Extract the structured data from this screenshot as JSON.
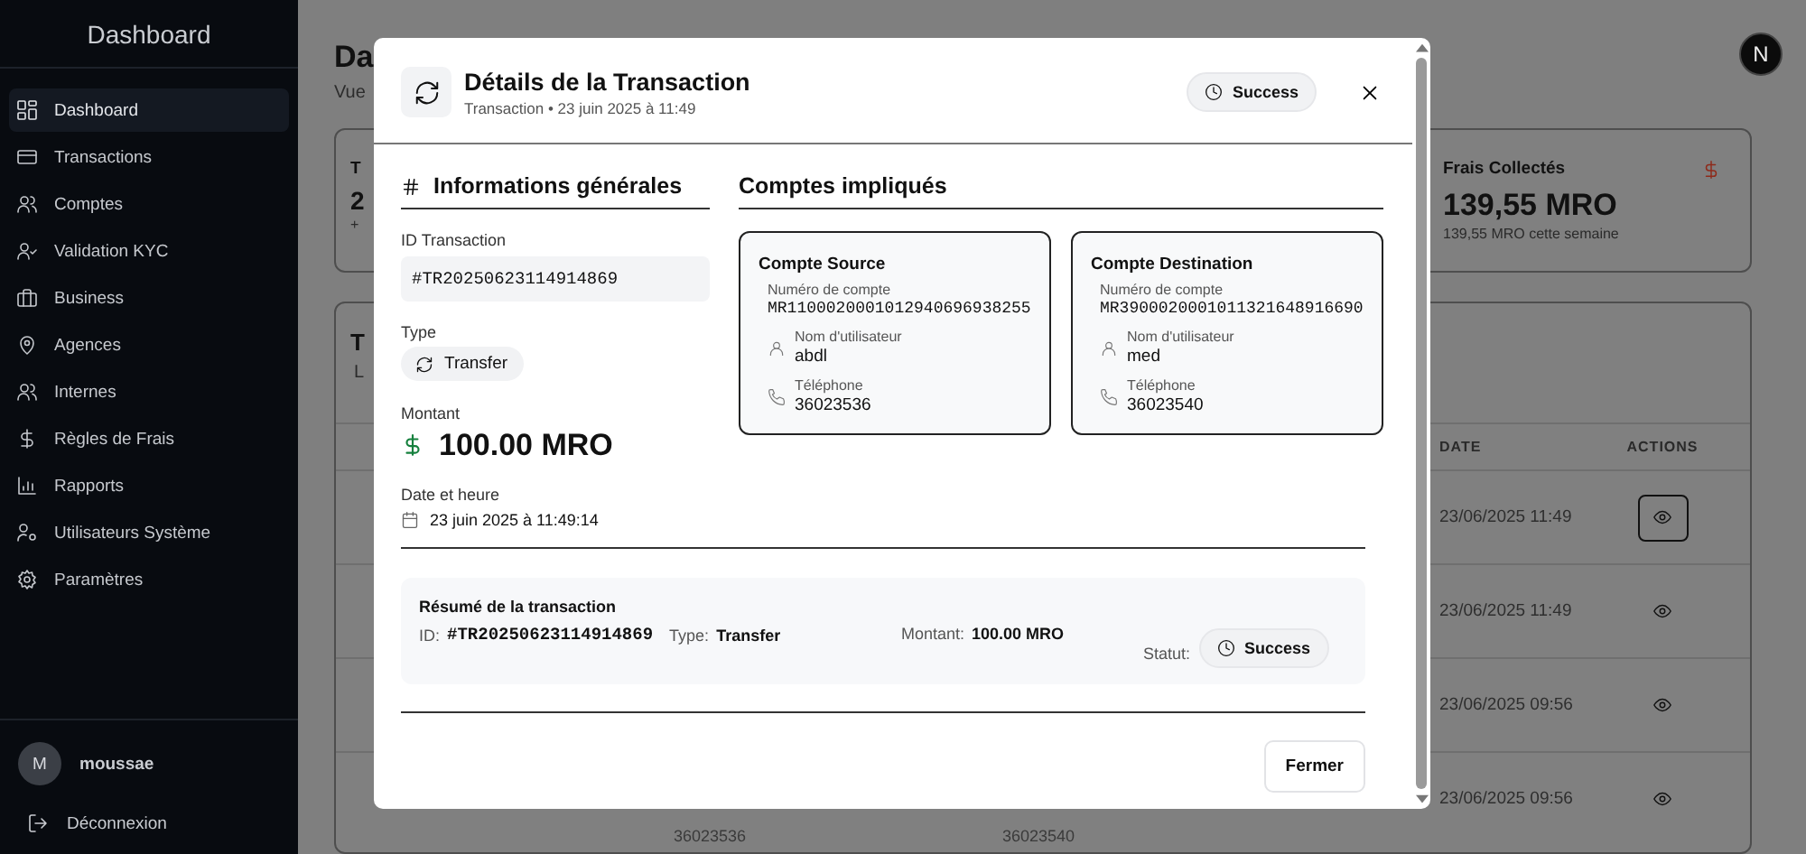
{
  "sidebar": {
    "title": "Dashboard",
    "items": [
      {
        "label": "Dashboard",
        "selected": true
      },
      {
        "label": "Transactions",
        "selected": false
      },
      {
        "label": "Comptes",
        "selected": false
      },
      {
        "label": "Validation KYC",
        "selected": false
      },
      {
        "label": "Business",
        "selected": false
      },
      {
        "label": "Agences",
        "selected": false
      },
      {
        "label": "Internes",
        "selected": false
      },
      {
        "label": "Règles de Frais",
        "selected": false
      },
      {
        "label": "Rapports",
        "selected": false
      },
      {
        "label": "Utilisateurs Système",
        "selected": false
      },
      {
        "label": "Paramètres",
        "selected": false
      }
    ],
    "user": {
      "initial": "M",
      "name": "moussae"
    },
    "logout": "Déconnexion"
  },
  "page": {
    "title": "Da",
    "subtitle": "Vue",
    "avatar": "N"
  },
  "stat_cards": [
    {
      "title": "T",
      "value": "2",
      "note": "+"
    },
    {
      "title": "Frais Collectés",
      "value": "139,55 MRO",
      "note": "139,55 MRO cette semaine"
    }
  ],
  "table": {
    "title": "T",
    "subtitle": "L",
    "columns": [
      "DATE",
      "ACTIONS"
    ],
    "rows": [
      {
        "date": "23/06/2025 11:49",
        "focused": true
      },
      {
        "date": "23/06/2025 11:49",
        "focused": false
      },
      {
        "date": "23/06/2025 09:56",
        "focused": false
      },
      {
        "date": "23/06/2025 09:56",
        "focused": false,
        "sender_phone": "36023536",
        "receiver_phone": "36023540"
      }
    ]
  },
  "modal": {
    "title": "Détails de la Transaction",
    "subtitle": "Transaction • 23 juin 2025 à 11:49",
    "status": "Success",
    "general": {
      "heading": "Informations générales",
      "id_label": "ID Transaction",
      "id": "#TR20250623114914869",
      "type_label": "Type",
      "type": "Transfer",
      "amount_label": "Montant",
      "amount": "100.00 MRO",
      "date_label": "Date et heure",
      "date": "23 juin 2025 à 11:49:14"
    },
    "accounts": {
      "heading": "Comptes impliqués",
      "cards": [
        {
          "title": "Compte Source",
          "number_label": "Numéro de compte",
          "number": "MR1100020001012940696938255",
          "user_label": "Nom d'utilisateur",
          "user": "abdl",
          "phone_label": "Téléphone",
          "phone": "36023536"
        },
        {
          "title": "Compte Destination",
          "number_label": "Numéro de compte",
          "number": "MR3900020001011321648916690",
          "user_label": "Nom d'utilisateur",
          "user": "med",
          "phone_label": "Téléphone",
          "phone": "36023540"
        }
      ]
    },
    "summary": {
      "title": "Résumé de la transaction",
      "id_label": "ID:",
      "id": "#TR20250623114914869",
      "type_label": "Type:",
      "type": "Transfer",
      "amount_label": "Montant:",
      "amount": "100.00 MRO",
      "status_label": "Statut:",
      "status": "Success"
    },
    "close_button": "Fermer"
  }
}
